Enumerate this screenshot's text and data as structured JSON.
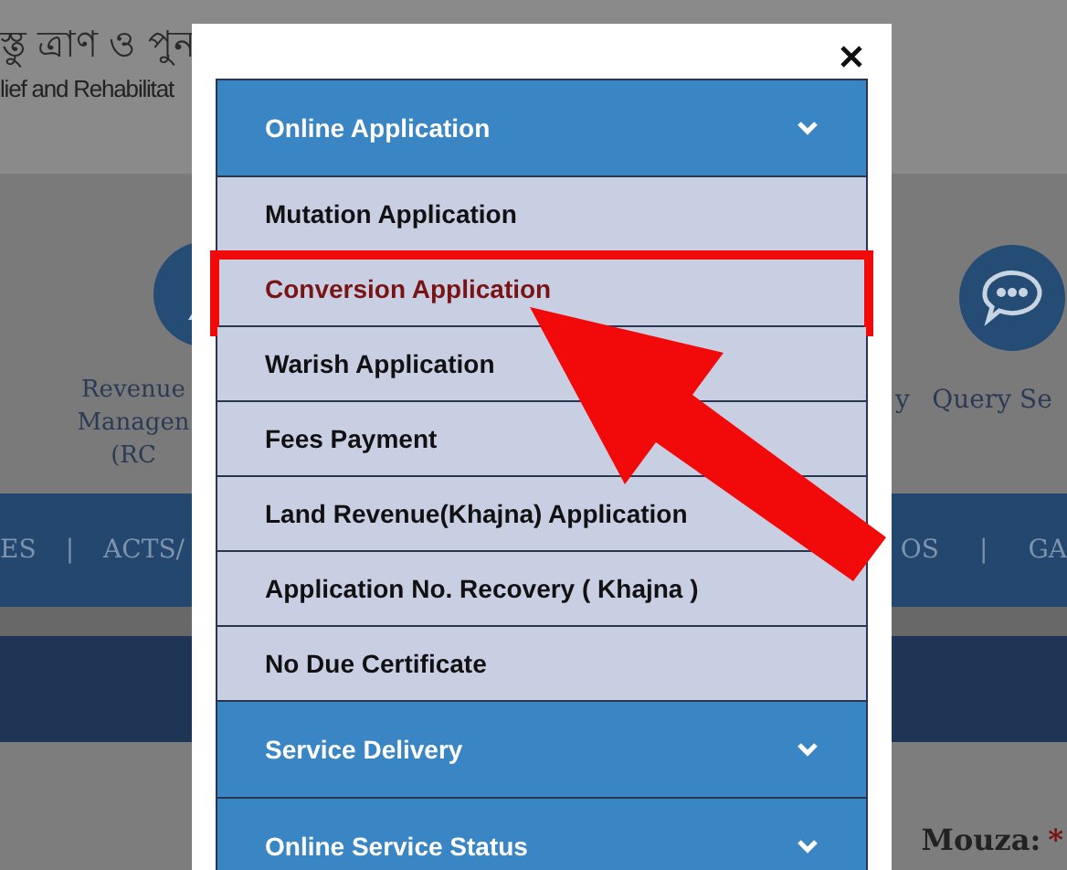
{
  "site_header": {
    "title_bengali": "স্তু ত্রাণ ও পুন",
    "title_english": "lief and Rehabilitat"
  },
  "services_left": [
    {
      "label_lines": [
        "Revenue",
        "Managen",
        "(RC"
      ]
    }
  ],
  "services_right": [
    {
      "kind": "text",
      "label": "y"
    },
    {
      "kind": "icon",
      "label": "Query Se"
    }
  ],
  "nav_left": [
    "ES",
    "|",
    "ACTS/"
  ],
  "nav_right": [
    "OS",
    "|",
    "GA"
  ],
  "form": {
    "label": "Mouza:",
    "required_mark": "*"
  },
  "modal": {
    "sections": [
      {
        "title": "Online Application",
        "items": [
          {
            "label": "Mutation Application",
            "selected": false
          },
          {
            "label": "Conversion Application",
            "selected": true
          },
          {
            "label": "Warish Application",
            "selected": false
          },
          {
            "label": "Fees Payment",
            "selected": false
          },
          {
            "label": "Land Revenue(Khajna) Application",
            "selected": false
          },
          {
            "label": "Application No. Recovery ( Khajna )",
            "selected": false
          },
          {
            "label": "No Due Certificate",
            "selected": false
          }
        ]
      },
      {
        "title": "Service Delivery"
      },
      {
        "title": "Online Service Status"
      }
    ]
  }
}
